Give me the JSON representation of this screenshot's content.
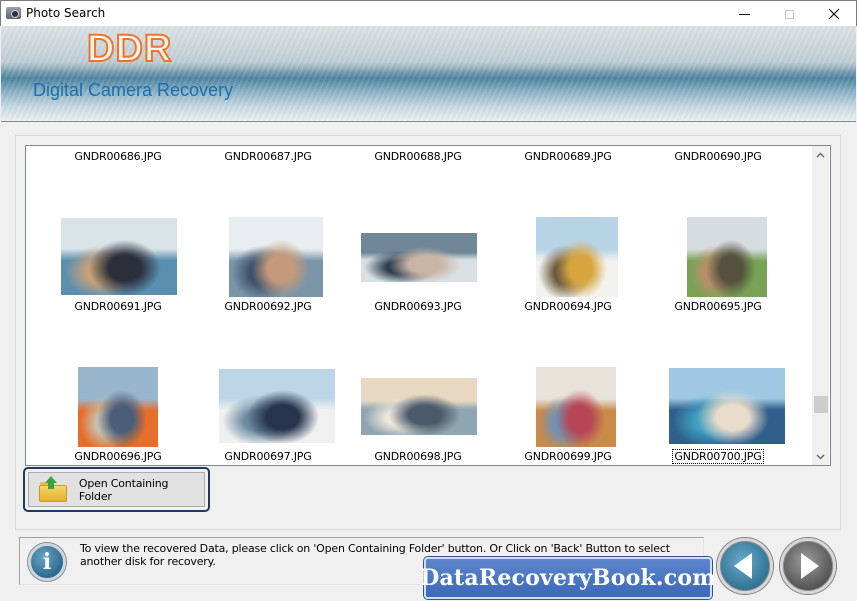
{
  "window": {
    "title": "Photo Search",
    "controls": {
      "minimize": "minimize",
      "maximize": "maximize",
      "close": "close"
    }
  },
  "header": {
    "logo": "DDR",
    "product_name": "Digital Camera Recovery"
  },
  "photos": {
    "rows": [
      {
        "items": [
          {
            "name": "GNDR00686.JPG",
            "visible_thumb": false
          },
          {
            "name": "GNDR00687.JPG",
            "visible_thumb": false
          },
          {
            "name": "GNDR00688.JPG",
            "visible_thumb": false
          },
          {
            "name": "GNDR00689.JPG",
            "visible_thumb": false
          },
          {
            "name": "GNDR00690.JPG",
            "visible_thumb": false
          }
        ]
      },
      {
        "items": [
          {
            "name": "GNDR00691.JPG",
            "thumb": "couple-on-sailboat",
            "colors": [
              "#d9e3e8",
              "#5a8fb0",
              "#2b2f3a",
              "#c9a27a"
            ]
          },
          {
            "name": "GNDR00692.JPG",
            "thumb": "mother-and-child-on-boat",
            "colors": [
              "#e8eef0",
              "#7a94a8",
              "#c49a7a",
              "#3d4f6b"
            ]
          },
          {
            "name": "GNDR00693.JPG",
            "thumb": "woman-on-speedboat",
            "colors": [
              "#6f8797",
              "#d9e0e4",
              "#c9b5a5",
              "#2c3e4e"
            ]
          },
          {
            "name": "GNDR00694.JPG",
            "thumb": "man-photographing-woman-on-deck",
            "colors": [
              "#b7d3e6",
              "#f2f2ee",
              "#d8a640",
              "#6a5a3e"
            ]
          },
          {
            "name": "GNDR00695.JPG",
            "thumb": "child-on-shoulders-near-airplane",
            "colors": [
              "#d6dde0",
              "#78a356",
              "#55513f",
              "#b98f6a"
            ]
          }
        ]
      },
      {
        "items": [
          {
            "name": "GNDR00696.JPG",
            "thumb": "couple-at-boat-railing",
            "colors": [
              "#9ab6cc",
              "#e76e2a",
              "#4a5e7a",
              "#c8c0ae"
            ]
          },
          {
            "name": "GNDR00697.JPG",
            "thumb": "couple-sitting-on-yacht",
            "colors": [
              "#bcd6e8",
              "#f0f0f0",
              "#26344d",
              "#6a8aa0"
            ]
          },
          {
            "name": "GNDR00698.JPG",
            "thumb": "couple-on-sailboat-sunset",
            "colors": [
              "#e8d8c2",
              "#8fa6b2",
              "#4b5a6a",
              "#f0e8dd"
            ]
          },
          {
            "name": "GNDR00699.JPG",
            "thumb": "travelers-with-luggage",
            "colors": [
              "#e9e2da",
              "#c98a4a",
              "#b74557",
              "#6f93b8"
            ]
          },
          {
            "name": "GNDR00700.JPG",
            "thumb": "seniors-on-yacht-marina",
            "colors": [
              "#9fc9e2",
              "#2e5f8d",
              "#e8dccb",
              "#3f9fbf"
            ],
            "selected": true
          }
        ]
      }
    ],
    "scroll": {
      "position_fraction": 0.87
    }
  },
  "actions": {
    "open_folder_label": "Open Containing Folder"
  },
  "info": {
    "message": "To view the recovered Data, please click on 'Open Containing Folder' button. Or Click on 'Back' Button to select another disk for recovery."
  },
  "watermark": {
    "text": "DataRecoveryBook.com"
  },
  "nav": {
    "back": "back",
    "next": "next"
  }
}
